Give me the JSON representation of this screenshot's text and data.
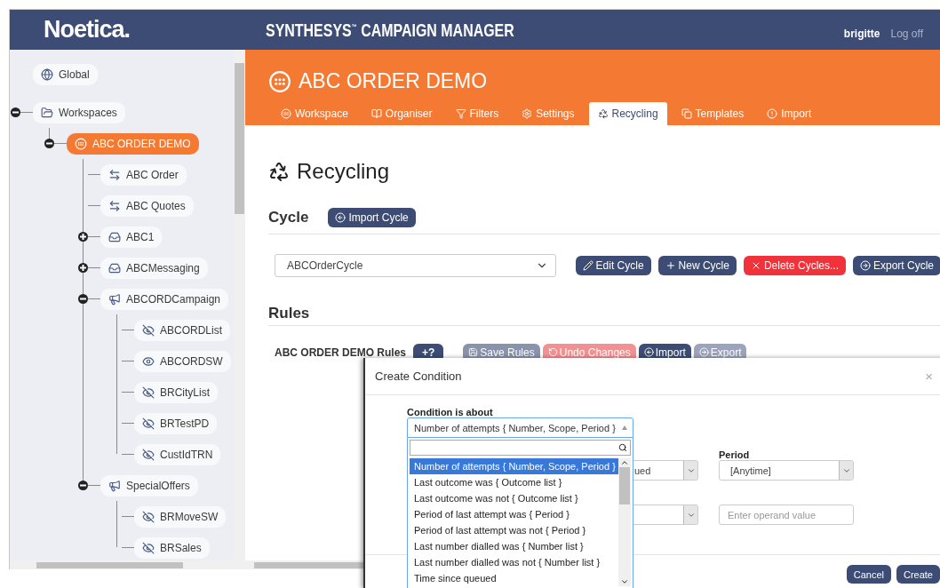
{
  "header": {
    "logo": "Noetica.",
    "title": "SYNTHESYS$^{™}$ CAMPAIGN MANAGER",
    "user": "brigitte",
    "logoff": "Log off"
  },
  "tree": [
    {
      "label": "Global",
      "kind": "globe",
      "selected": false
    },
    {
      "label": "Workspaces",
      "kind": "folder",
      "selected": false,
      "expanded": true,
      "children": [
        {
          "label": "ABC ORDER DEMO",
          "kind": "workspace",
          "selected": true,
          "expanded": true,
          "children": [
            {
              "label": "ABC Order",
              "kind": "queue",
              "selected": false
            },
            {
              "label": "ABC Quotes",
              "kind": "queue",
              "selected": false
            },
            {
              "label": "ABC1",
              "kind": "system",
              "selected": false,
              "expanded": false
            },
            {
              "label": "ABCMessaging",
              "kind": "system",
              "selected": false,
              "expanded": false
            },
            {
              "label": "ABCORDCampaign",
              "kind": "campaign",
              "selected": false,
              "expanded": true,
              "children": [
                {
                  "label": "ABCORDList",
                  "kind": "list",
                  "visible": false,
                  "selected": false
                },
                {
                  "label": "ABCORDSW",
                  "kind": "list",
                  "visible": true,
                  "selected": false
                },
                {
                  "label": "BRCityList",
                  "kind": "list",
                  "visible": false,
                  "selected": false
                },
                {
                  "label": "BRTestPD",
                  "kind": "list",
                  "visible": false,
                  "selected": false
                },
                {
                  "label": "CustIdTRN",
                  "kind": "list",
                  "visible": false,
                  "selected": false
                }
              ]
            },
            {
              "label": "SpecialOffers",
              "kind": "campaign",
              "selected": false,
              "expanded": true,
              "children": [
                {
                  "label": "BRMoveSW",
                  "kind": "list",
                  "visible": false,
                  "selected": false
                },
                {
                  "label": "BRSales",
                  "kind": "list",
                  "visible": false,
                  "selected": false
                }
              ]
            }
          ]
        }
      ]
    }
  ],
  "workspace": {
    "title": "ABC ORDER DEMO",
    "tabs": [
      {
        "label": "Workspace",
        "kind": "workspace",
        "selected": false
      },
      {
        "label": "Organiser",
        "kind": "organiser",
        "selected": false
      },
      {
        "label": "Filters",
        "kind": "filters",
        "selected": false
      },
      {
        "label": "Settings",
        "kind": "settings",
        "selected": false
      },
      {
        "label": "Recycling",
        "kind": "recycling",
        "selected": true
      },
      {
        "label": "Templates",
        "kind": "templates",
        "selected": false
      },
      {
        "label": "Import",
        "kind": "import",
        "selected": false
      }
    ]
  },
  "page": {
    "heading": "Recycling",
    "cycle_heading": "Cycle",
    "import_cycle": "Import Cycle",
    "cycle_value": "ABCOrderCycle",
    "cycle_buttons": [
      {
        "label": "Edit Cycle",
        "kind": "edit"
      },
      {
        "label": "New Cycle",
        "kind": "new"
      },
      {
        "label": "Delete Cycles...",
        "kind": "delete"
      },
      {
        "label": "Export Cycle",
        "kind": "export"
      }
    ],
    "rules_heading": "Rules",
    "rules_name": "ABC ORDER DEMO Rules",
    "add_button": "+?",
    "rule_tools": [
      {
        "label": "Save Rules",
        "kind": "save",
        "disabled": true
      },
      {
        "label": "Undo Changes",
        "kind": "undo",
        "disabled": true
      },
      {
        "label": "Import",
        "kind": "import",
        "disabled": false
      },
      {
        "label": "Export",
        "kind": "export",
        "disabled": true
      }
    ]
  },
  "modal": {
    "title": "Create Condition",
    "close": "×",
    "condition_label": "Condition is about",
    "condition_value": "Number of attempts { Number, Scope, Period }",
    "options": [
      {
        "label": "Number of attempts { Number, Scope, Period }",
        "selected": true
      },
      {
        "label": "Last outcome was { Outcome list }",
        "selected": false
      },
      {
        "label": "Last outcome was not { Outcome list }",
        "selected": false
      },
      {
        "label": "Period of last attempt was { Period }",
        "selected": false
      },
      {
        "label": "Period of last attempt was not { Period }",
        "selected": false
      },
      {
        "label": "Last number dialled was { Number list }",
        "selected": false
      },
      {
        "label": "Last number dialled was not { Number list }",
        "selected": false
      },
      {
        "label": "Time since queued",
        "selected": false
      }
    ],
    "scope_value": "ued",
    "period_label": "Period",
    "period_value": "[Anytime]",
    "operand_placeholder": "Enter operand value",
    "buttons": [
      "Cancel",
      "Create"
    ]
  }
}
